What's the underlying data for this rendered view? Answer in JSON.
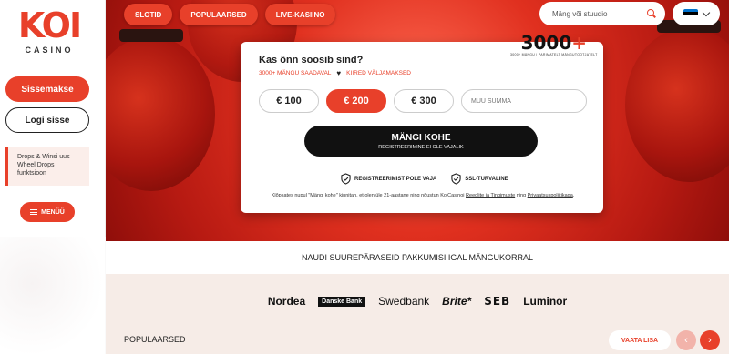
{
  "sidebar": {
    "logo_text": "KOI",
    "logo_sub": "CASINO",
    "deposit_label": "Sissemakse",
    "login_label": "Logi sisse",
    "promo_text": "Drops & Winsi uus Wheel Drops funktsioon",
    "menu_label": "MENÜÜ"
  },
  "header": {
    "tabs": [
      "SLOTID",
      "POPULAARSED",
      "LIVE-KASIINO"
    ],
    "search_placeholder": "Mäng või stuudio",
    "language_flag": "estonia-flag"
  },
  "card": {
    "title": "Kas õnn soosib sind?",
    "sub_left": "3000+ MÄNGU SAADAVAL",
    "sub_right": "KIIRED VÄLJAMAKSED",
    "badge_number": "3000",
    "badge_plus": "+",
    "badge_caption": "3000+ MÄNGU | PARIMATELT MÄNGUTOOTJATELT",
    "amounts": [
      "€ 100",
      "€ 200",
      "€ 300"
    ],
    "amount_selected_index": 1,
    "custom_amount_placeholder": "MUU SUMMA",
    "play_label": "MÄNGI KOHE",
    "play_sub": "REGISTREERIMINE EI OLE VAJALIK",
    "feature_1": "REGISTREERIMIST POLE VAJA",
    "feature_2": "SSL-TURVALINE",
    "terms_before": "Klõpsates nupul \"Mängi kohe\" kinnitan, et olen üle 21-aastane ning nõustun KoiCasinoi ",
    "terms_link_1": "Reeglite ja Tingimuste",
    "terms_middle": " ning ",
    "terms_link_2": "Privaatsuspoliitikaga",
    "terms_after": "."
  },
  "strip_text": "NAUDI SUUREPÄRASEID PAKKUMISI IGAL MÄNGUKORRAL",
  "banks": [
    "Nordea",
    "Danske Bank",
    "Swedbank",
    "Brite*",
    "SEB",
    "Luminor"
  ],
  "popular": {
    "label": "POPULAARSED",
    "see_more": "VAATA LISA",
    "prev_icon": "‹",
    "next_icon": "›"
  },
  "colors": {
    "accent": "#e8402a",
    "dark": "#111111"
  }
}
